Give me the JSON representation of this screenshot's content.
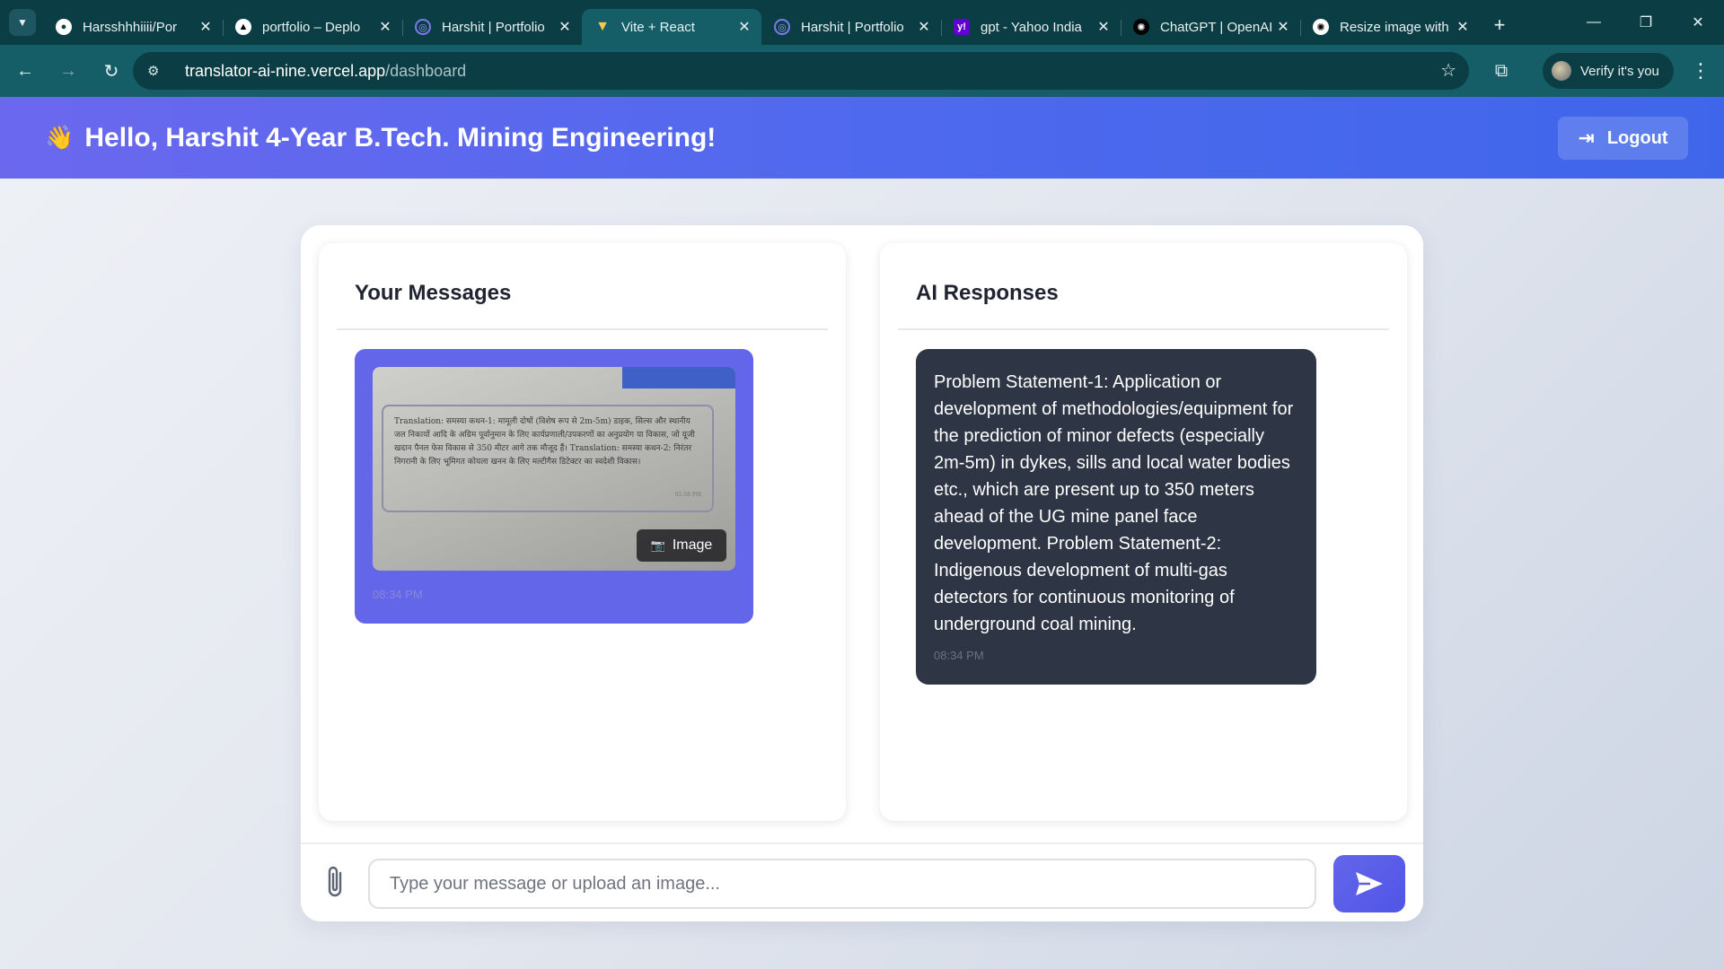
{
  "browser": {
    "tabs": [
      {
        "title": "Harsshhhiiii/Por",
        "icon": "github-icon",
        "color": "#ffffff"
      },
      {
        "title": "portfolio – Deplo",
        "icon": "vercel-icon",
        "color": "#000000"
      },
      {
        "title": "Harshit | Portfolio",
        "icon": "portfolio-icon",
        "color": "#5a5ae0"
      },
      {
        "title": "Vite + React",
        "icon": "vite-icon",
        "color": "#a855f7",
        "active": true
      },
      {
        "title": "Harshit | Portfolio",
        "icon": "portfolio-icon",
        "color": "#5a5ae0"
      },
      {
        "title": "gpt - Yahoo India",
        "icon": "yahoo-icon",
        "color": "#6001d2"
      },
      {
        "title": "ChatGPT | OpenAI",
        "icon": "openai-icon",
        "color": "#000000"
      },
      {
        "title": "Resize image with",
        "icon": "openai-icon",
        "color": "#000000"
      }
    ],
    "url_host": "translator-ai-nine.vercel.app",
    "url_path": "/dashboard",
    "verify_label": "Verify it's you"
  },
  "header": {
    "wave": "👋",
    "greeting": "Hello, Harshit 4-Year B.Tech. Mining Engineering!",
    "logout_label": "Logout"
  },
  "messages": {
    "title": "Your Messages",
    "items": [
      {
        "type": "image",
        "image_text": "Translation: समस्या कथन-1: मामूली दोषों (विशेष रूप से 2m-5m) डाइक, सिल्स और स्थानीय जल निकायों आदि के अग्रिम पूर्वानुमान के लिए कार्यप्रणाली/उपकरणों का अनुप्रयोग या विकास, जो यूजी खदान पैनल फेस विकास से 350 मीटर आगे तक मौजूद हैं। Translation: समस्या कथन-2: निरंतर निगरानी के लिए भूमिगत कोयला खनन के लिए मल्टीगैस डिटेक्टर का स्वदेशी विकास।",
        "image_time": "02:58 PM",
        "tag_label": "Image",
        "time": "08:34 PM"
      }
    ]
  },
  "responses": {
    "title": "AI Responses",
    "items": [
      {
        "text": "Problem Statement-1: Application or development of methodologies/equipment for the prediction of minor defects (especially 2m-5m) in dykes, sills and local water bodies etc., which are present up to 350 meters ahead of the UG mine panel face development. Problem Statement-2: Indigenous development of multi-gas detectors for continuous monitoring of underground coal mining.",
        "time": "08:34 PM"
      }
    ]
  },
  "composer": {
    "placeholder": "Type your message or upload an image...",
    "value": ""
  },
  "colors": {
    "accent": "#6466ea",
    "header_start": "#6b68ee",
    "header_end": "#3f66ea",
    "ai_bubble": "#2e3544",
    "browser_frame": "#0b3d44"
  }
}
